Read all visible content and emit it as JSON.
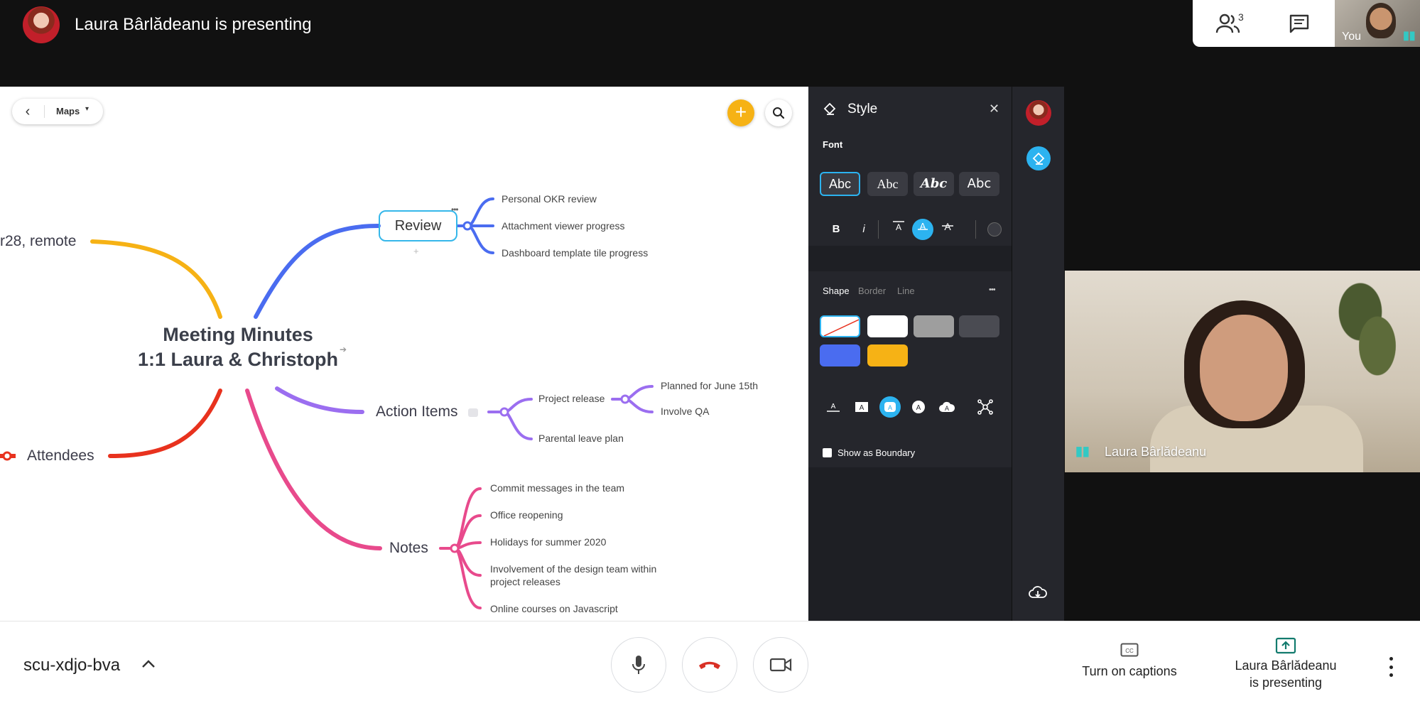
{
  "topbar": {
    "presenting_title": "Laura Bârlădeanu is presenting",
    "people_count": "3",
    "self_label": "You"
  },
  "canvas": {
    "maps_label": "Maps",
    "main_node": {
      "line1": "Meeting Minutes",
      "line2": "1:1 Laura & Christoph"
    },
    "left_nodes": {
      "date_node": "r28, remote",
      "attendees": "Attendees"
    },
    "review": {
      "label": "Review",
      "items": [
        "Personal OKR review",
        "Attachment viewer progress",
        "Dashboard template tile progress"
      ]
    },
    "action_items": {
      "label": "Action Items",
      "project_release": "Project release",
      "project_release_items": [
        "Planned for June 15th",
        "Involve QA"
      ],
      "parental_leave": "Parental leave plan"
    },
    "notes": {
      "label": "Notes",
      "items": [
        "Commit messages in the team",
        "Office reopening",
        "Holidays for summer 2020",
        "Involvement of the design team within",
        "project releases",
        "Online courses on Javascript"
      ]
    },
    "colors": {
      "review": "#4a6cf0",
      "action": "#9b6ef0",
      "notes": "#e84a8c",
      "date": "#f6b215",
      "attendees": "#e8321e"
    }
  },
  "style_panel": {
    "title": "Style",
    "font_label": "Font",
    "font_options": [
      "Abc",
      "Abc",
      "Abc",
      "Abc"
    ],
    "bold": "B",
    "italic": "i",
    "tabs": [
      "Shape",
      "Border",
      "Line"
    ],
    "show_boundary": "Show as Boundary",
    "swatch_colors": [
      "#ffffff",
      "#9e9e9e",
      "#4a4b52",
      "#4a6cf0",
      "#f6b215"
    ]
  },
  "participant": {
    "name": "Laura Bârlădeanu"
  },
  "bottombar": {
    "meeting_code": "scu-xdjo-bva",
    "captions_label": "Turn on captions",
    "presenting_line1": "Laura Bârlădeanu",
    "presenting_line2": "is presenting"
  }
}
